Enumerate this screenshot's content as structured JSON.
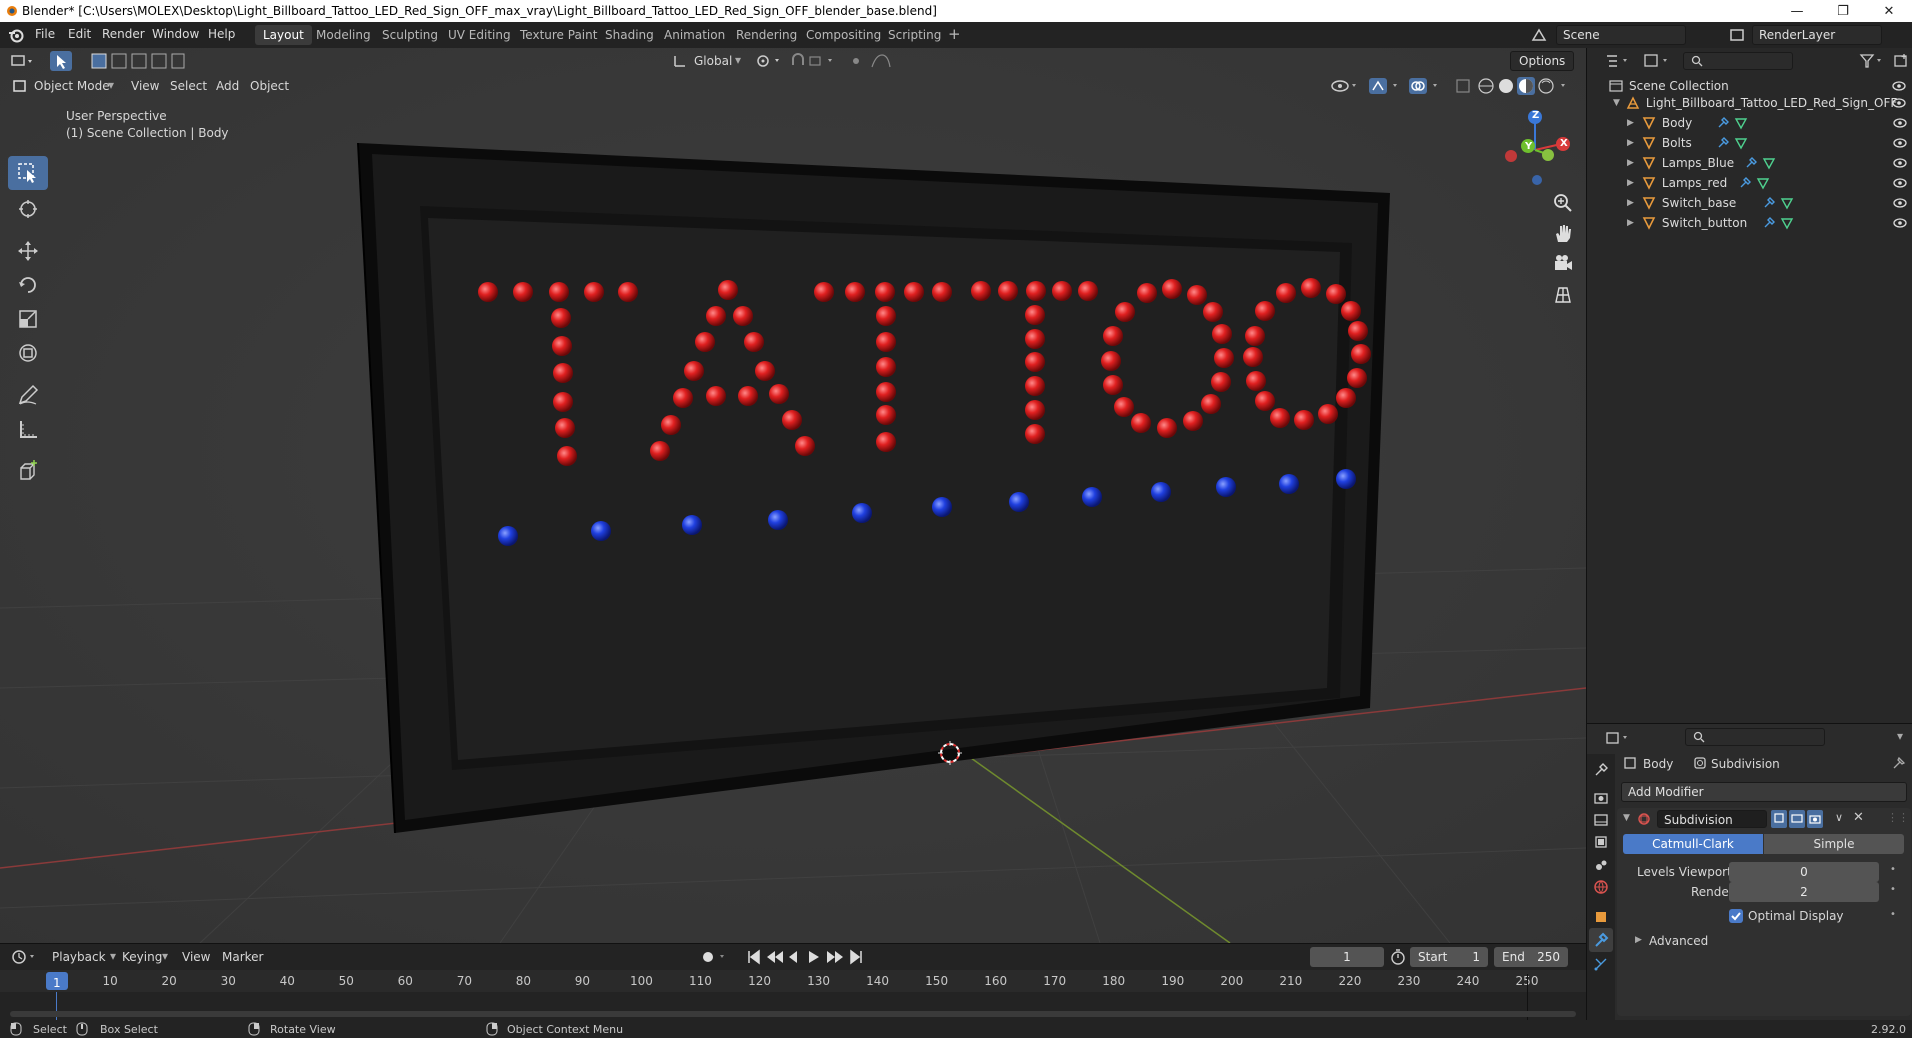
{
  "window": {
    "title": "Blender* [C:\\Users\\MOLEX\\Desktop\\Light_Billboard_Tattoo_LED_Red_Sign_OFF_max_vray\\Light_Billboard_Tattoo_LED_Red_Sign_OFF_blender_base.blend]",
    "min_icon": "minimize-icon",
    "max_icon": "maximize-icon",
    "close_icon": "close-icon"
  },
  "menu": [
    "File",
    "Edit",
    "Render",
    "Window",
    "Help"
  ],
  "workspaces": [
    "Layout",
    "Modeling",
    "Sculpting",
    "UV Editing",
    "Texture Paint",
    "Shading",
    "Animation",
    "Rendering",
    "Compositing",
    "Scripting"
  ],
  "active_workspace": "Layout",
  "scene": {
    "name": "Scene",
    "render_layer": "RenderLayer"
  },
  "viewport_header": {
    "mode": "Object Mode",
    "menus": [
      "View",
      "Select",
      "Add",
      "Object"
    ],
    "orientation": "Global",
    "options": "Options"
  },
  "viewport": {
    "perspective": "User Perspective",
    "context": "(1) Scene Collection | Body",
    "sign_text": "TATTOO",
    "led_red": "#e02020",
    "led_blue": "#2040e0"
  },
  "gizmo_axes": {
    "x": "X",
    "y": "Y",
    "z": "Z"
  },
  "timeline": {
    "menus": [
      "Playback",
      "Keying",
      "View",
      "Marker"
    ],
    "current_frame": "1",
    "start_label": "Start",
    "start": "1",
    "end_label": "End",
    "end": "250",
    "ticks": [
      "1",
      "10",
      "20",
      "30",
      "40",
      "50",
      "60",
      "70",
      "80",
      "90",
      "100",
      "110",
      "120",
      "130",
      "140",
      "150",
      "160",
      "170",
      "180",
      "190",
      "200",
      "210",
      "220",
      "230",
      "240",
      "250"
    ]
  },
  "status": {
    "select": "Select",
    "box_select": "Box Select",
    "rotate": "Rotate View",
    "context_menu": "Object Context Menu",
    "version": "2.92.0"
  },
  "outliner": {
    "root": "Scene Collection",
    "collection": "Light_Billboard_Tattoo_LED_Red_Sign_OFF",
    "objects": [
      "Body",
      "Bolts",
      "Lamps_Blue",
      "Lamps_red",
      "Switch_base",
      "Switch_button"
    ]
  },
  "properties": {
    "object": "Body",
    "modifier_name_header": "Subdivision",
    "add_modifier": "Add Modifier",
    "modifier_name": "Subdivision",
    "catmull": "Catmull-Clark",
    "simple": "Simple",
    "levels_viewport_label": "Levels Viewport",
    "levels_viewport": "0",
    "render_label": "Render",
    "render": "2",
    "optimal_display": "Optimal Display",
    "advanced": "Advanced"
  }
}
